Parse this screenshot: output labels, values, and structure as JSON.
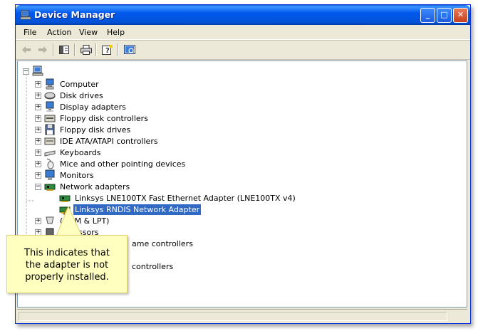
{
  "window": {
    "title": "Device Manager",
    "controls": {
      "minimize": "_",
      "maximize": "□",
      "close": "✕"
    }
  },
  "menu": [
    "File",
    "Action",
    "View",
    "Help"
  ],
  "toolbar": {
    "buttons": [
      "back-icon",
      "forward-icon",
      "properties-pane-icon",
      "print-icon",
      "help-icon",
      "scan-hardware-icon"
    ]
  },
  "tree": {
    "root": "computer-icon",
    "categories": [
      {
        "label": "Computer",
        "icon": "computer-icon"
      },
      {
        "label": "Disk drives",
        "icon": "disk-drive-icon"
      },
      {
        "label": "Display adapters",
        "icon": "display-icon"
      },
      {
        "label": "Floppy disk controllers",
        "icon": "floppy-controller-icon"
      },
      {
        "label": "Floppy disk drives",
        "icon": "floppy-drive-icon"
      },
      {
        "label": "IDE ATA/ATAPI controllers",
        "icon": "ide-controller-icon"
      },
      {
        "label": "Keyboards",
        "icon": "keyboard-icon"
      },
      {
        "label": "Mice and other pointing devices",
        "icon": "mouse-icon"
      },
      {
        "label": "Monitors",
        "icon": "monitor-icon"
      },
      {
        "label": "Network adapters",
        "icon": "network-adapter-icon"
      }
    ],
    "network_children": [
      {
        "label": "Linksys LNE100TX Fast Ethernet Adapter (LNE100TX v4)",
        "icon": "network-card-icon"
      },
      {
        "label": "Linksys RNDIS Network Adapter",
        "icon": "network-card-warning-icon"
      }
    ],
    "partial": [
      {
        "label": "(COM & LPT)"
      },
      {
        "label": "ssors"
      },
      {
        "label": "ame controllers"
      },
      {
        "label": "controllers"
      }
    ]
  },
  "callout": {
    "text": "This indicates that the adapter is not properly installed.",
    "lines": [
      "This indicates that",
      "the adapter is not",
      "properly installed."
    ]
  },
  "colors": {
    "title_bar": "#0058ee",
    "selection": "#316ac5",
    "callout_bg": "#ffffc0",
    "chrome": "#ece9d8"
  }
}
